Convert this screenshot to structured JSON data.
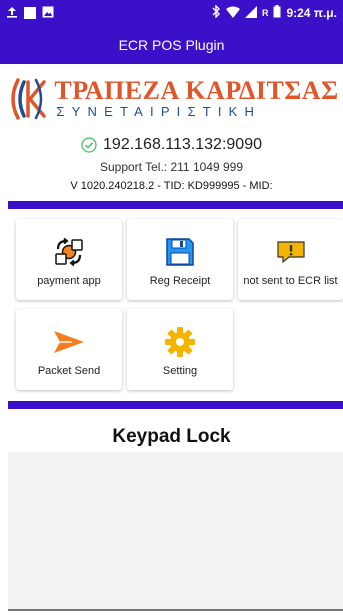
{
  "status_bar": {
    "icons_left": [
      "upload-icon",
      "square-icon",
      "image-icon"
    ],
    "icons_right": [
      "bluetooth-icon",
      "wifi-icon",
      "signal-icon",
      "battery-icon"
    ],
    "roaming": "R",
    "time": "9:24 π.μ."
  },
  "app": {
    "title": "ECR POS Plugin"
  },
  "logo": {
    "main": "ΤΡΑΠΕΖΑ ΚΑΡΔΙΤΣΑΣ",
    "sub": "ΣΥΝΕΤΑΙΡΙΣΤΙΚΗ",
    "colors": {
      "orange": "#e0552a",
      "blue": "#1f4f8f"
    }
  },
  "connection": {
    "ip": "192.168.113.132:9090",
    "support": "Support Tel.: 211 1049 999",
    "version": "V 1020.240218.2 - TID: KD999995 - MID:"
  },
  "tiles": [
    {
      "label": "payment app",
      "icon": "payment-app-icon"
    },
    {
      "label": "Reg Receipt",
      "icon": "floppy-disk-icon"
    },
    {
      "label": "not sent to ECR list",
      "icon": "alert-chat-icon"
    },
    {
      "label": "Packet Send",
      "icon": "send-icon"
    },
    {
      "label": "Setting",
      "icon": "gear-icon"
    }
  ],
  "keypad": {
    "title": "Keypad Lock"
  },
  "colors": {
    "accent": "#3a10c9",
    "orange": "#f58220",
    "gold": "#f4b400"
  }
}
